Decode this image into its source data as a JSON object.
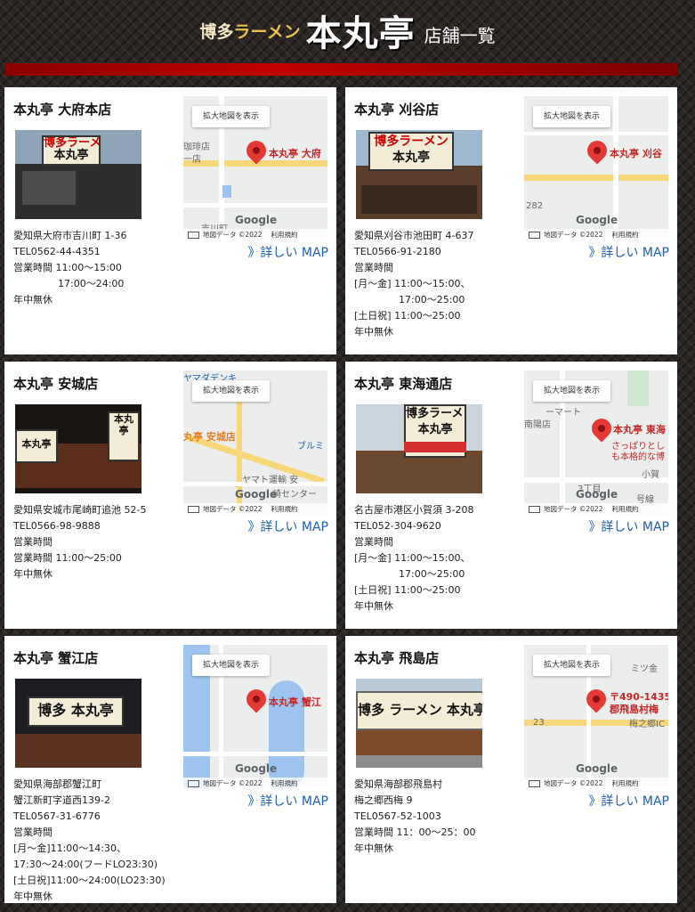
{
  "header": {
    "brand_prefix": "博多",
    "brand_ramen": "ラーメン",
    "brand_name": "本丸亭",
    "suffix": "店舗一覧"
  },
  "map_common": {
    "expand_button": "拡大地図を表示",
    "google": "Google",
    "map_data": "地図データ ©2022",
    "terms": "利用規約",
    "detail_link": "》詳しい MAP"
  },
  "stores": [
    {
      "name": "本丸亭 大府本店",
      "map_label": "本丸亭 大府",
      "lines": [
        "愛知県大府市吉川町 1-36",
        "TEL0562-44-4351",
        "営業時間 11:00～15:00"
      ],
      "indent_lines": [
        "17:00～24:00"
      ],
      "tail": [
        "年中無休"
      ],
      "map_misc": [
        "吉川町",
        "珈琲店",
        "一店"
      ]
    },
    {
      "name": "本丸亭 刈谷店",
      "map_label": "本丸亭 刈谷",
      "lines": [
        "愛知県刈谷市池田町 4-637",
        "TEL0566-91-2180",
        "営業時間",
        "[月～金] 11:00～15:00、"
      ],
      "indent_lines": [
        "17:00～25:00"
      ],
      "tail": [
        "[土日祝] 11:00～25:00",
        "年中無休"
      ],
      "map_misc": [
        "282"
      ]
    },
    {
      "name": "本丸亭 安城店",
      "map_label": "丸亭 安城店",
      "lines": [
        "愛知県安城市尾崎町追池 52-5",
        "TEL0566-98-9888",
        "営業時間",
        "営業時間 11:00～25:00"
      ],
      "indent_lines": [],
      "tail": [
        "年中無休"
      ],
      "map_misc": [
        "ヤマダデンキ",
        "ブルミ",
        "ヤマト運輸 安",
        "崎センター"
      ]
    },
    {
      "name": "本丸亭 東海通店",
      "map_label": "本丸亭 東海",
      "lines": [
        "名古屋市港区小賀須 3-208",
        "TEL052-304-9620",
        "営業時間",
        "[月～金] 11:00～15:00、"
      ],
      "indent_lines": [
        "17:00～25:00"
      ],
      "tail": [
        "[土日祝] 11:00～25:00",
        "年中無休"
      ],
      "map_misc": [
        "ーマート",
        "南陽店",
        "さっぱりとし",
        "も本格的な博",
        "小賀",
        "3丁目",
        "号線"
      ]
    },
    {
      "name": "本丸亭 蟹江店",
      "map_label": "本丸亭 蟹江",
      "lines": [
        "愛知県海部郡蟹江町",
        "蟹江新町字道西139-2",
        "TEL0567-31-6776",
        "営業時間",
        "[月～金]11:00～14:30、",
        "17:30～24:00(フードLO23:30)",
        "[土日祝]11:00～24:00(LO23:30)",
        "年中無休"
      ],
      "indent_lines": [],
      "tail": [],
      "map_misc": []
    },
    {
      "name": "本丸亭 飛島店",
      "map_label": "〒490-1435",
      "map_label2": "郡飛島村梅",
      "lines": [
        "愛知県海部郡飛島村",
        "梅之郷西梅 9",
        "TEL0567-52-1003",
        "営業時間 11：00～25：00",
        "年中無休"
      ],
      "indent_lines": [],
      "tail": [],
      "map_misc": [
        "ミツ金",
        "23",
        "梅之郷IC"
      ]
    }
  ]
}
